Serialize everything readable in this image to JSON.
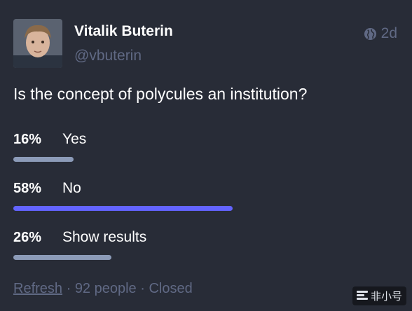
{
  "status": {
    "display_name": "Vitalik Buterin",
    "handle": "@vbuterin",
    "visibility_icon": "globe-icon",
    "timestamp": "2d",
    "content": "Is the concept of polycules an institution?"
  },
  "poll": {
    "options": [
      {
        "percent_label": "16%",
        "label": "Yes",
        "value": 0.16,
        "leading": false
      },
      {
        "percent_label": "58%",
        "label": "No",
        "value": 0.58,
        "leading": true
      },
      {
        "percent_label": "26%",
        "label": "Show results",
        "value": 0.26,
        "leading": false
      }
    ],
    "footer": {
      "refresh": "Refresh",
      "separator1": " · ",
      "voters": "92 people",
      "separator2": " · ",
      "state": "Closed"
    }
  },
  "watermark": {
    "text": "非小号"
  },
  "colors": {
    "background": "#282c37",
    "muted": "#606984",
    "bar_leading": "#6364ff",
    "bar_default": "#8c9bb8"
  }
}
